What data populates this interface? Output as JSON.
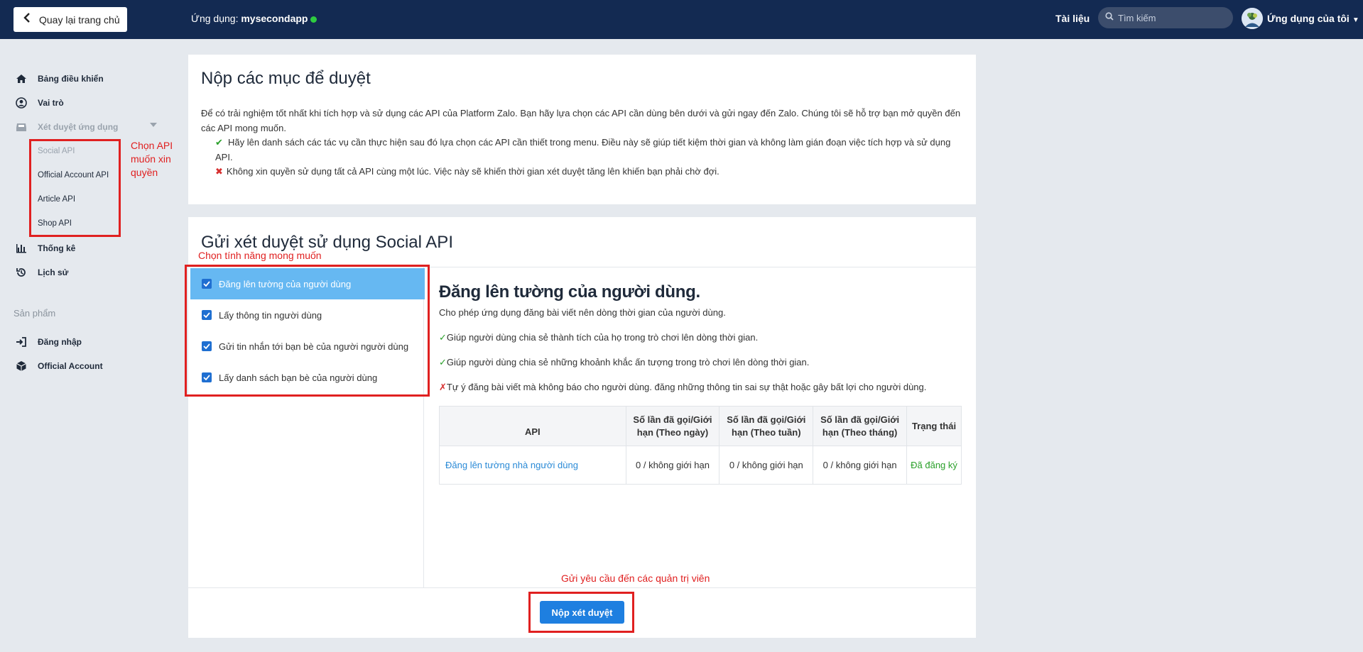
{
  "header": {
    "back_label": "Quay lại trang chủ",
    "app_prefix": "Ứng dụng: ",
    "app_name": "mysecondapp",
    "docs_label": "Tài liệu",
    "search_placeholder": "Tìm kiếm",
    "my_apps_label": "Ứng dụng của tôi"
  },
  "sidebar": {
    "items": [
      {
        "label": "Bảng điều khiển"
      },
      {
        "label": "Vai trò"
      },
      {
        "label": "Xét duyệt ứng dụng"
      },
      {
        "label": "Thống kê"
      },
      {
        "label": "Lịch sử"
      }
    ],
    "sub_items": [
      {
        "label": "Social API"
      },
      {
        "label": "Official Account API"
      },
      {
        "label": "Article API"
      },
      {
        "label": "Shop API"
      }
    ],
    "products_title": "Sản phẩm",
    "product_items": [
      {
        "label": "Đăng nhập"
      },
      {
        "label": "Official Account"
      }
    ]
  },
  "annotations": {
    "choose_api": "Chọn API muốn xin quyền",
    "choose_feature": "Chọn tính năng mong muốn",
    "send_request": "Gửi yêu cầu đến các quản trị viên"
  },
  "intro_card": {
    "title": "Nộp các mục để duyệt",
    "paragraph": "Để có trải nghiệm tốt nhất khi tích hợp và sử dụng các API của Platform Zalo. Bạn hãy lựa chọn các API cần dùng bên dưới và gửi ngay đến Zalo. Chúng tôi sẽ hỗ trợ bạn mở quyền đến các API mong muốn.",
    "do_item": "Hãy lên danh sách các tác vụ cần thực hiện sau đó lựa chọn các API cần thiết trong menu. Điều này sẽ giúp tiết kiệm thời gian và không làm gián đoạn việc tích hợp và sử dụng API.",
    "dont_item": "Không xin quyền sử dụng tất cả API cùng một lúc. Việc này sẽ khiến thời gian xét duyệt tăng lên khiến bạn phải chờ đợi."
  },
  "review_card": {
    "title": "Gửi xét duyệt sử dụng Social API",
    "features": [
      {
        "label": "Đăng lên tường của người dùng",
        "checked": true
      },
      {
        "label": "Lấy thông tin người dùng",
        "checked": true
      },
      {
        "label": "Gửi tin nhắn tới bạn bè của người người dùng",
        "checked": true
      },
      {
        "label": "Lấy danh sách bạn bè của người dùng",
        "checked": true
      }
    ],
    "detail": {
      "title": "Đăng lên tường của người dùng.",
      "description": "Cho phép ứng dụng đăng bài viết nên dòng thời gian của người dùng.",
      "do_1": "Giúp người dùng chia sẻ thành tích của họ trong trò chơi lên dòng thời gian.",
      "do_2": "Giúp người dùng chia sẻ những khoảnh khắc ấn tượng trong trò chơi lên dòng thời gian.",
      "dont_1": "Tự ý đăng bài viết mà không báo cho người dùng. đăng những thông tin sai sự thật hoặc gây bất lợi cho người dùng."
    },
    "table": {
      "headers": [
        "API",
        "Số lần đã gọi/Giới hạn (Theo ngày)",
        "Số lần đã gọi/Giới hạn (Theo tuần)",
        "Số lần đã gọi/Giới hạn (Theo tháng)",
        "Trạng thái"
      ],
      "rows": [
        [
          "Đăng lên tường nhà người dùng",
          "0 / không giới hạn",
          "0 / không giới hạn",
          "0 / không giới hạn",
          "Đã đăng ký"
        ]
      ]
    },
    "submit_label": "Nộp xét duyệt"
  },
  "colors": {
    "header_bg": "#132a52",
    "accent": "#1e7fe0",
    "active_feature": "#66b8f2",
    "annotation_red": "#e02020",
    "status_green": "#2aa02a"
  }
}
